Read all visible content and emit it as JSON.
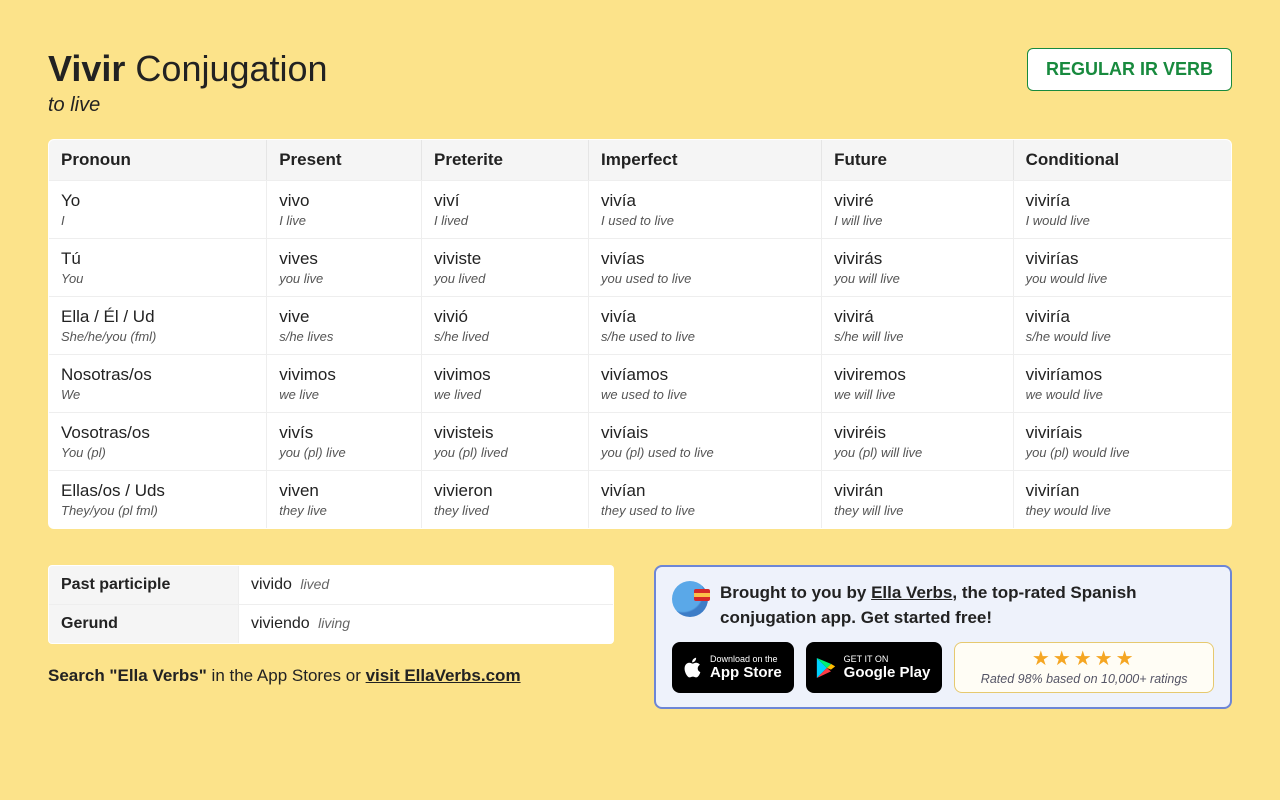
{
  "header": {
    "verb": "Vivir",
    "title_rest": "Conjugation",
    "translation": "to live",
    "badge": "REGULAR IR VERB"
  },
  "columns": [
    "Pronoun",
    "Present",
    "Preterite",
    "Imperfect",
    "Future",
    "Conditional"
  ],
  "rows": [
    {
      "pronoun": {
        "main": "Yo",
        "sub": "I"
      },
      "cells": [
        {
          "main": "vivo",
          "sub": "I live"
        },
        {
          "main": "viví",
          "sub": "I lived"
        },
        {
          "main": "vivía",
          "sub": "I used to live"
        },
        {
          "main": "viviré",
          "sub": "I will live"
        },
        {
          "main": "viviría",
          "sub": "I would live"
        }
      ]
    },
    {
      "pronoun": {
        "main": "Tú",
        "sub": "You"
      },
      "cells": [
        {
          "main": "vives",
          "sub": "you live"
        },
        {
          "main": "viviste",
          "sub": "you lived"
        },
        {
          "main": "vivías",
          "sub": "you used to live"
        },
        {
          "main": "vivirás",
          "sub": "you will live"
        },
        {
          "main": "vivirías",
          "sub": "you would live"
        }
      ]
    },
    {
      "pronoun": {
        "main": "Ella / Él / Ud",
        "sub": "She/he/you (fml)"
      },
      "cells": [
        {
          "main": "vive",
          "sub": "s/he lives"
        },
        {
          "main": "vivió",
          "sub": "s/he lived"
        },
        {
          "main": "vivía",
          "sub": "s/he used to live"
        },
        {
          "main": "vivirá",
          "sub": "s/he will live"
        },
        {
          "main": "viviría",
          "sub": "s/he would live"
        }
      ]
    },
    {
      "pronoun": {
        "main": "Nosotras/os",
        "sub": "We"
      },
      "cells": [
        {
          "main": "vivimos",
          "sub": "we live"
        },
        {
          "main": "vivimos",
          "sub": "we lived"
        },
        {
          "main": "vivíamos",
          "sub": "we used to live"
        },
        {
          "main": "viviremos",
          "sub": "we will live"
        },
        {
          "main": "viviríamos",
          "sub": "we would live"
        }
      ]
    },
    {
      "pronoun": {
        "main": "Vosotras/os",
        "sub": "You (pl)"
      },
      "cells": [
        {
          "main": "vivís",
          "sub": "you (pl) live"
        },
        {
          "main": "vivisteis",
          "sub": "you (pl) lived"
        },
        {
          "main": "vivíais",
          "sub": "you (pl) used to live"
        },
        {
          "main": "viviréis",
          "sub": "you (pl) will live"
        },
        {
          "main": "viviríais",
          "sub": "you (pl) would live"
        }
      ]
    },
    {
      "pronoun": {
        "main": "Ellas/os / Uds",
        "sub": "They/you (pl fml)"
      },
      "cells": [
        {
          "main": "viven",
          "sub": "they live"
        },
        {
          "main": "vivieron",
          "sub": "they lived"
        },
        {
          "main": "vivían",
          "sub": "they used to live"
        },
        {
          "main": "vivirán",
          "sub": "they will live"
        },
        {
          "main": "vivirían",
          "sub": "they would live"
        }
      ]
    }
  ],
  "participles": {
    "past_label": "Past participle",
    "past_main": "vivido",
    "past_sub": "lived",
    "gerund_label": "Gerund",
    "gerund_main": "viviendo",
    "gerund_sub": "living"
  },
  "search_line": {
    "bold": "Search \"Ella Verbs\"",
    "rest": " in the App Stores or ",
    "link": "visit EllaVerbs.com"
  },
  "promo": {
    "text_before": "Brought to you by ",
    "link": "Ella Verbs",
    "text_after": ", the top-rated Spanish conjugation app. Get started free!",
    "appstore_small": "Download on the",
    "appstore_big": "App Store",
    "play_small": "GET IT ON",
    "play_big": "Google Play",
    "rating_text": "Rated 98% based on 10,000+ ratings"
  }
}
